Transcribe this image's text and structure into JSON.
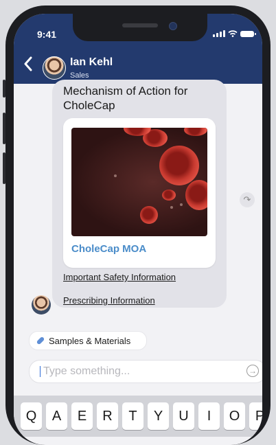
{
  "status_bar": {
    "time": "9:41"
  },
  "header": {
    "name": "Ian Kehl",
    "role": "Sales"
  },
  "message": {
    "title": "Mechanism of Action for CholeCap",
    "card_title": "CholeCap MOA",
    "links": [
      "Important Safety Information",
      "Prescribing Information"
    ]
  },
  "chip": {
    "label": "Samples & Materials"
  },
  "compose": {
    "placeholder": "Type something..."
  },
  "keyboard": {
    "keys": [
      "Q",
      "A",
      "E",
      "R",
      "T",
      "Y",
      "U",
      "I",
      "O",
      "P"
    ]
  },
  "icons": {
    "back": "chevron-left-icon",
    "share": "share-forward-icon",
    "send": "send-arrow-icon",
    "chip": "pill-icon"
  },
  "colors": {
    "header_bg": "#233a6e",
    "accent": "#4a8cc9"
  }
}
